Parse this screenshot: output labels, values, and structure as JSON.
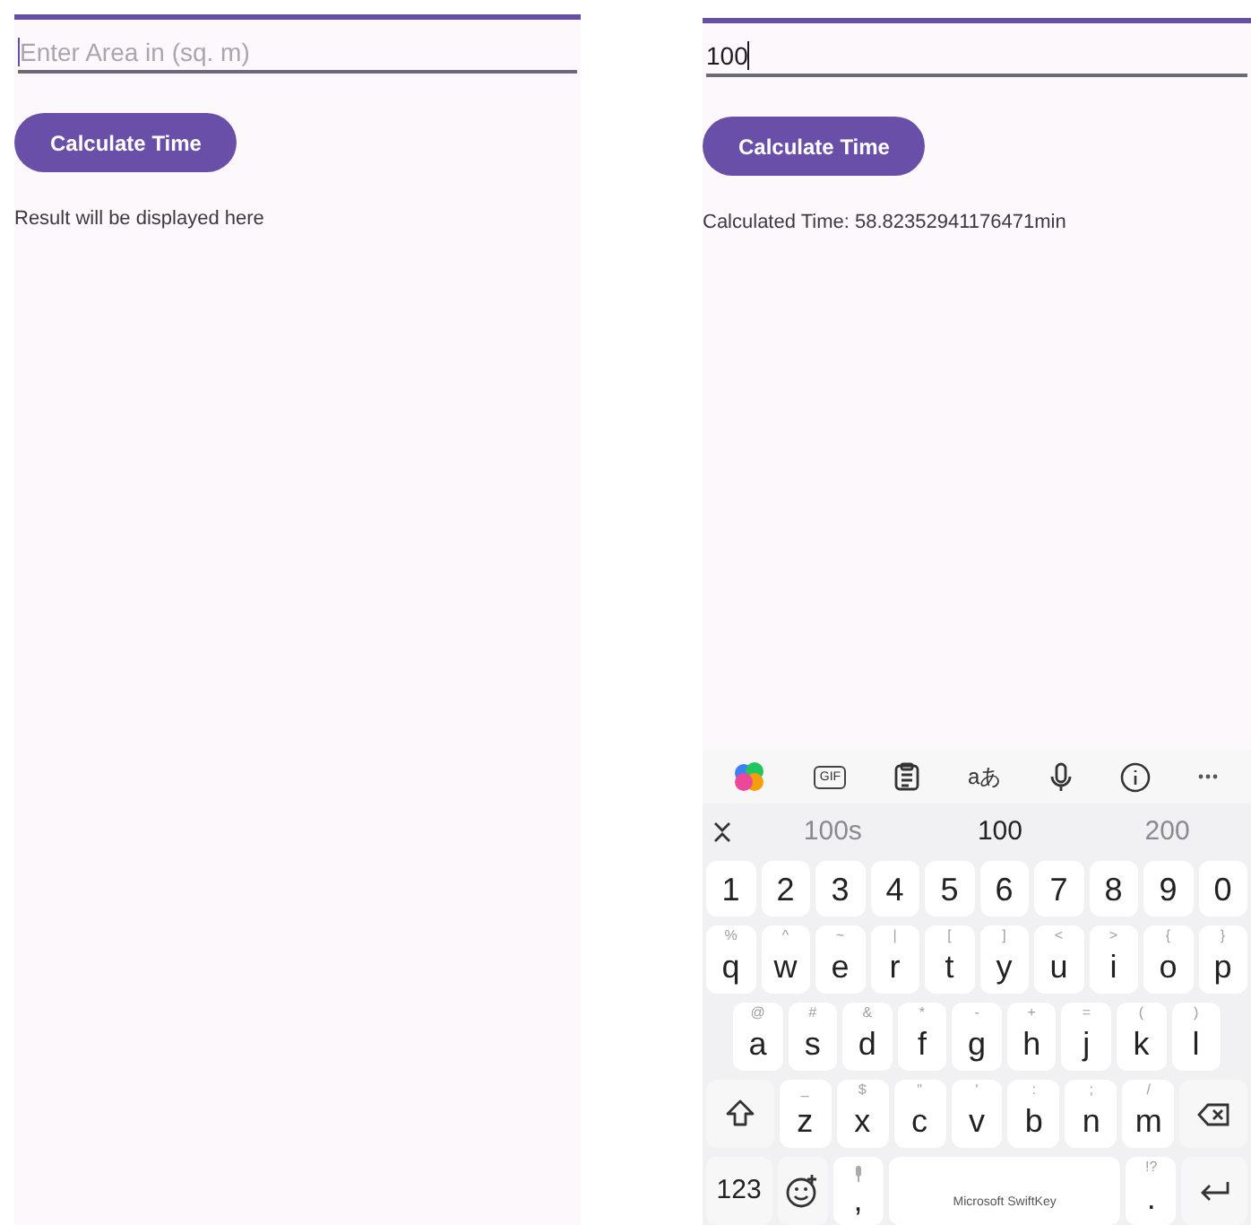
{
  "screens": [
    {
      "field": {
        "placeholder": "Enter Area in (sq. m)",
        "focused": true
      },
      "button": "Calculate Time",
      "result": "Result will be displayed here"
    },
    {
      "field": {
        "value": "100",
        "focused": true
      },
      "button": "Calculate Time",
      "result": "Calculated Time: 58.82352941176471min",
      "keyboard": {
        "toolbar": {
          "gif": "GIF",
          "translate": "aあ"
        },
        "suggestions": [
          {
            "text": "100s",
            "selected": false
          },
          {
            "text": "100",
            "selected": true
          },
          {
            "text": "200",
            "selected": false
          }
        ],
        "key_rows": [
          {
            "keys": [
              {
                "label": "1"
              },
              {
                "label": "2"
              },
              {
                "label": "3"
              },
              {
                "label": "4"
              },
              {
                "label": "5"
              },
              {
                "label": "6"
              },
              {
                "label": "7"
              },
              {
                "label": "8"
              },
              {
                "label": "9"
              },
              {
                "label": "0"
              }
            ]
          },
          {
            "keys": [
              {
                "label": "q",
                "hint": "%"
              },
              {
                "label": "w",
                "hint": "^"
              },
              {
                "label": "e",
                "hint": "~"
              },
              {
                "label": "r",
                "hint": "|"
              },
              {
                "label": "t",
                "hint": "["
              },
              {
                "label": "y",
                "hint": "]"
              },
              {
                "label": "u",
                "hint": "<"
              },
              {
                "label": "i",
                "hint": ">"
              },
              {
                "label": "o",
                "hint": "{"
              },
              {
                "label": "p",
                "hint": "}"
              }
            ]
          },
          {
            "keys": [
              {
                "label": "a",
                "hint": "@"
              },
              {
                "label": "s",
                "hint": "#"
              },
              {
                "label": "d",
                "hint": "&"
              },
              {
                "label": "f",
                "hint": "*"
              },
              {
                "label": "g",
                "hint": "-"
              },
              {
                "label": "h",
                "hint": "+"
              },
              {
                "label": "j",
                "hint": "="
              },
              {
                "label": "k",
                "hint": "("
              },
              {
                "label": "l",
                "hint": ")"
              }
            ]
          },
          {
            "keys": [
              {
                "kind": "shift"
              },
              {
                "label": "z",
                "hint": "_"
              },
              {
                "label": "x",
                "hint": "$"
              },
              {
                "label": "c",
                "hint": "\""
              },
              {
                "label": "v",
                "hint": "'"
              },
              {
                "label": "b",
                "hint": ":"
              },
              {
                "label": "n",
                "hint": ";"
              },
              {
                "label": "m",
                "hint": "/"
              },
              {
                "kind": "backspace"
              }
            ]
          },
          {
            "keys": [
              {
                "label": "123",
                "kind": "plain"
              },
              {
                "kind": "emoji"
              },
              {
                "label": ",",
                "kind": "mic"
              },
              {
                "label": "Microsoft SwiftKey",
                "kind": "space"
              },
              {
                "label": ".",
                "hint": "!?"
              },
              {
                "kind": "enter"
              }
            ]
          }
        ]
      }
    }
  ]
}
